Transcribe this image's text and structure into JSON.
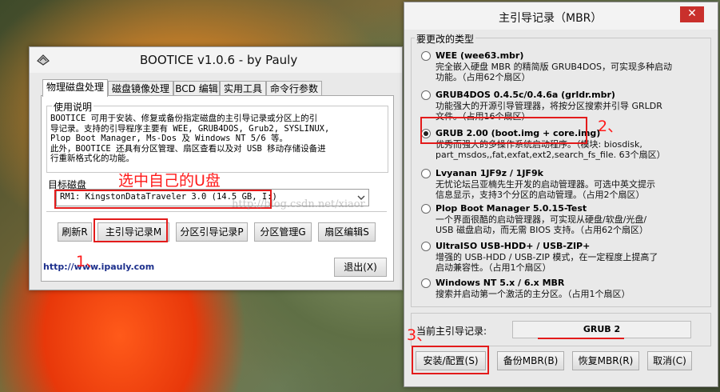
{
  "win1": {
    "title": "BOOTICE v1.0.6 - by Pauly",
    "tabs": [
      "物理磁盘处理",
      "磁盘镜像处理",
      "BCD 编辑",
      "实用工具",
      "命令行参数"
    ],
    "usage_group_title": "使用说明",
    "usage_lines": [
      "BOOTICE 可用于安装、修复或备份指定磁盘的主引导记录或分区上的引",
      "导记录。支持的引导程序主要有 WEE, GRUB4DOS, Grub2, SYSLINUX,",
      "Plop Boot Manager, Ms-Dos 及 Windows NT 5/6 等。",
      "此外，BOOTICE 还具有分区管理、扇区查看以及对 USB 移动存储设备进",
      "行重新格式化的功能。"
    ],
    "target_group_title": "目标磁盘",
    "disk_select_value": "RM1: KingstonDataTraveler 3.0 (14.5 GB, I:)",
    "buttons": {
      "refresh": "刷新R",
      "mbr": "主引导记录M",
      "pbr": "分区引导记录P",
      "parts": "分区管理G",
      "sector": "扇区编辑S",
      "exit": "退出(X)"
    },
    "link": "http://www.ipauly.com"
  },
  "annotations": {
    "select_udisk": "选中自己的U盘",
    "step1": "1、",
    "step2": "2、",
    "step3": "3、"
  },
  "watermark": "http://blog.csdn.net/xiaor",
  "win2": {
    "title": "主引导记录（MBR）",
    "group_title": "要更改的类型",
    "options": [
      {
        "label": "WEE (wee63.mbr)",
        "desc": [
          "完全嵌入硬盘 MBR 的精简版 GRUB4DOS，可实现多种启动",
          "功能。（占用62个扇区）"
        ],
        "selected": false
      },
      {
        "label": "GRUB4DOS 0.4.5c/0.4.6a (grldr.mbr)",
        "desc": [
          "功能强大的开源引导管理器，将按分区搜索并引导 GRLDR",
          "文件。（占用16个扇区）"
        ],
        "selected": false
      },
      {
        "label": "GRUB 2.00 (boot.img + core.img)",
        "desc": [
          "优秀而强大的多操作系统启动程序。（模块: biosdisk,",
          "part_msdos,,fat,exfat,ext2,search_fs_file. 63个扇区）"
        ],
        "selected": true
      },
      {
        "label": "Lvyanan 1JF9z / 1JF9k",
        "desc": [
          "无忧论坛吕亚楠先生开发的启动管理器。可选中英文提示",
          "信息显示，支持3个分区的启动管理。（占用2个扇区）"
        ],
        "selected": false
      },
      {
        "label": "Plop Boot Manager 5.0.15-Test",
        "desc": [
          "一个界面很酷的启动管理器，可实现从硬盘/软盘/光盘/",
          "USB 磁盘启动，而无需 BIOS 支持。（占用62个扇区）"
        ],
        "selected": false
      },
      {
        "label": "UltraISO USB-HDD+ / USB-ZIP+",
        "desc": [
          "增强的 USB-HDD / USB-ZIP 模式，在一定程度上提高了",
          "启动兼容性。（占用1个扇区）"
        ],
        "selected": false
      },
      {
        "label": "Windows NT 5.x / 6.x MBR",
        "desc": [
          "搜索并启动第一个激活的主分区。（占用1个扇区）"
        ],
        "selected": false
      }
    ],
    "current_label": "当前主引导记录:",
    "current_value": "GRUB 2",
    "buttons": {
      "install": "安装/配置(S)",
      "backup": "备份MBR(B)",
      "restore": "恢复MBR(R)",
      "cancel": "取消(C)"
    }
  }
}
